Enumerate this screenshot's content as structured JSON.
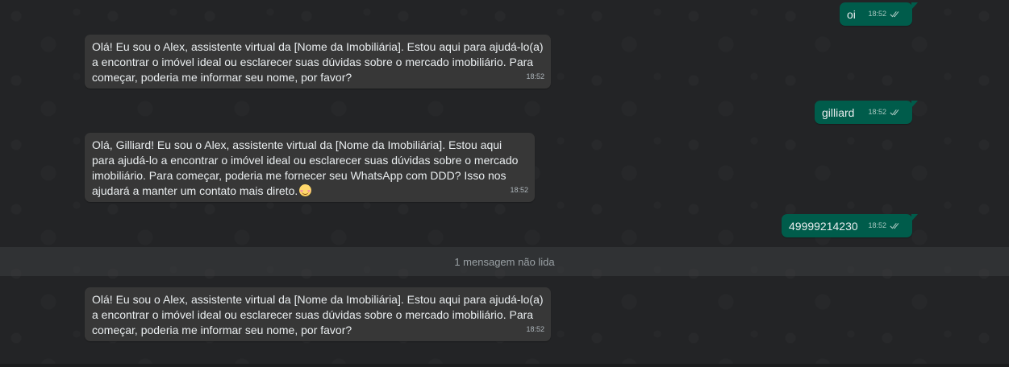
{
  "messages": [
    {
      "direction": "outgoing",
      "text": "oi",
      "time": "18:52"
    },
    {
      "direction": "incoming",
      "text": "Olá! Eu sou o Alex, assistente virtual da [Nome da Imobiliária]. Estou aqui para ajudá-lo(a) a encontrar o imóvel ideal ou esclarecer suas dúvidas sobre o mercado imobiliário. Para começar, poderia me informar seu nome, por favor?",
      "time": "18:52"
    },
    {
      "direction": "outgoing",
      "text": "gilliard",
      "time": "18:52"
    },
    {
      "direction": "incoming",
      "text": "Olá, Gilliard! Eu sou o Alex, assistente virtual da [Nome da Imobiliária]. Estou aqui para ajudá-lo a encontrar o imóvel ideal ou esclarecer suas dúvidas sobre o mercado imobiliário. Para começar, poderia me fornecer seu WhatsApp com DDD? Isso nos ajudará a manter um contato mais direto.",
      "emoji": "smiling-face-icon",
      "time": "18:52"
    },
    {
      "direction": "outgoing",
      "text": "49999214230",
      "time": "18:52"
    },
    {
      "direction": "incoming",
      "text": "Olá! Eu sou o Alex, assistente virtual da [Nome da Imobiliária]. Estou aqui para ajudá-lo(a) a encontrar o imóvel ideal ou esclarecer suas dúvidas sobre o mercado imobiliário. Para começar, poderia me informar seu nome, por favor?",
      "time": "18:52"
    }
  ],
  "unread_divider": "1 mensagem não lida",
  "colors": {
    "background": "#232426",
    "incoming_bubble": "#373737",
    "outgoing_bubble": "#005c4b",
    "text": "#e9edef"
  },
  "icons": {
    "read_receipt": "double-check-icon"
  }
}
